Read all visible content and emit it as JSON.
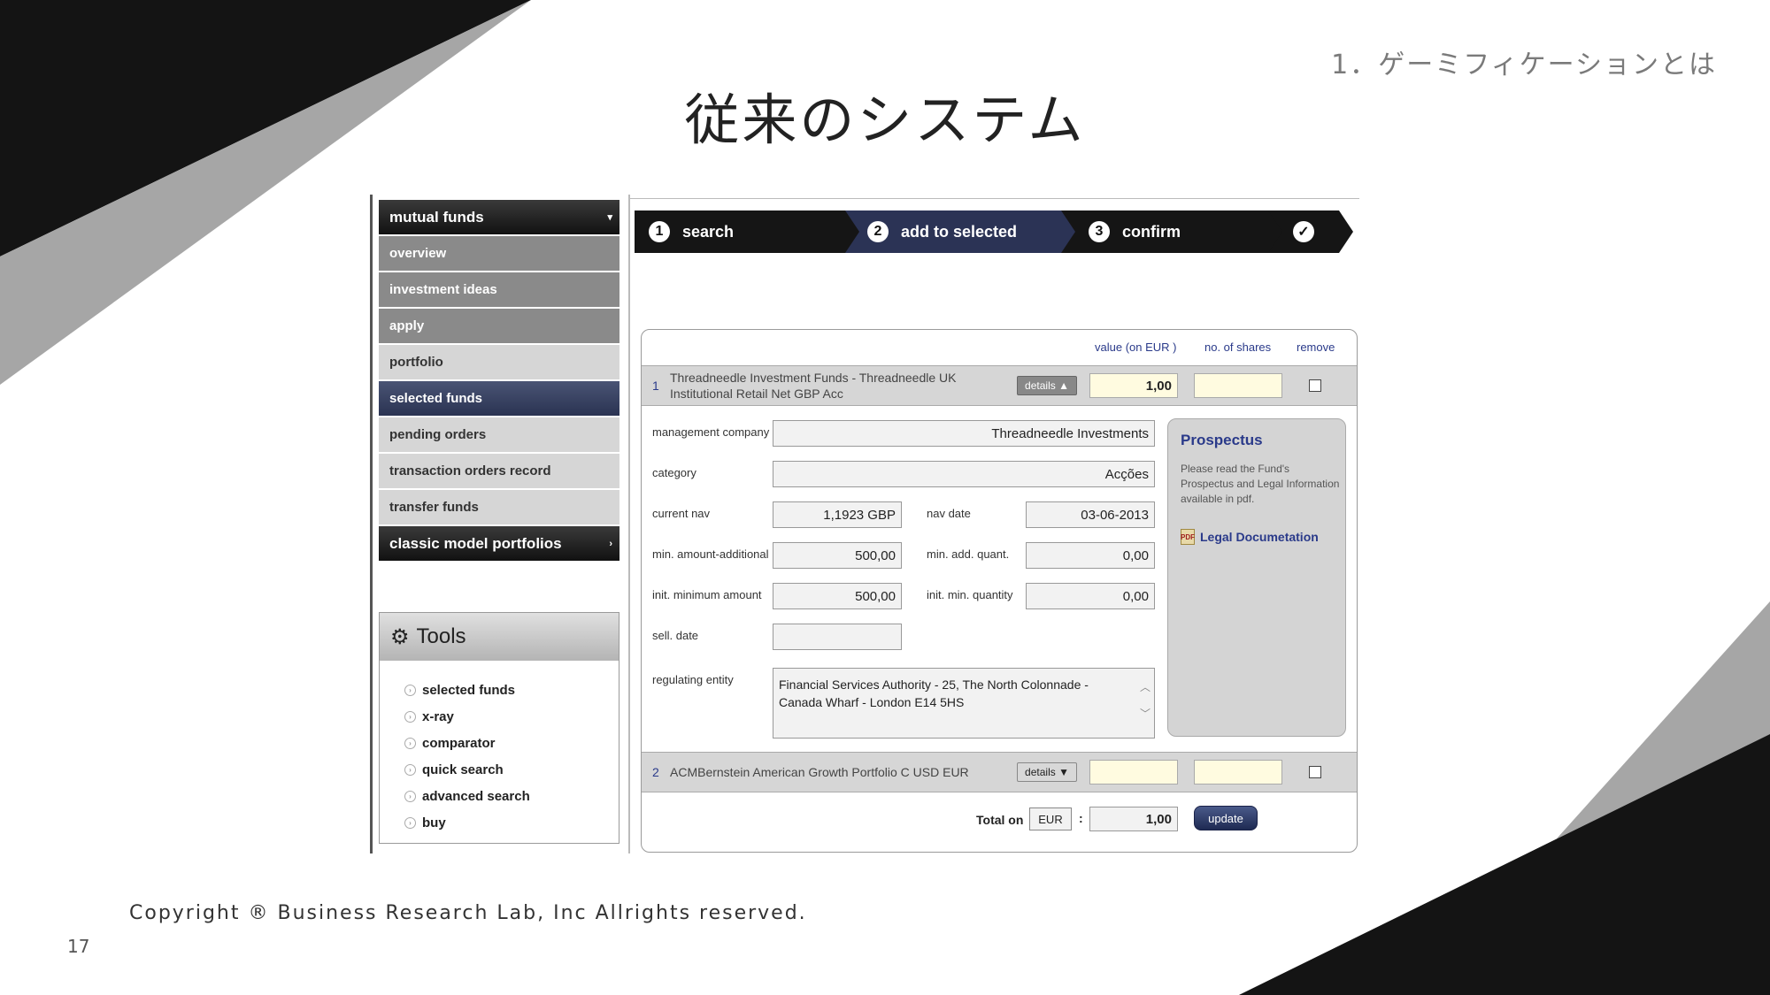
{
  "slide": {
    "section_label": "1．ゲーミフィケーションとは",
    "title": "従来のシステム",
    "copyright": "Copyright ® Business Research Lab, Inc Allrights reserved.",
    "page_number": "17"
  },
  "sidebar": {
    "items": [
      {
        "label": "mutual funds",
        "style": "dark",
        "arrow": "▾"
      },
      {
        "label": "overview",
        "style": "grey"
      },
      {
        "label": "investment ideas",
        "style": "grey"
      },
      {
        "label": "apply",
        "style": "grey"
      },
      {
        "label": "portfolio",
        "style": "light"
      },
      {
        "label": "selected funds",
        "style": "selected"
      },
      {
        "label": "pending orders",
        "style": "light"
      },
      {
        "label": "transaction orders record",
        "style": "light"
      },
      {
        "label": "transfer funds",
        "style": "light"
      },
      {
        "label": "classic model portfolios",
        "style": "dark",
        "arrow": "›"
      }
    ]
  },
  "tools": {
    "title": "Tools",
    "items": [
      "selected funds",
      "x-ray",
      "comparator",
      "quick search",
      "advanced search",
      "buy"
    ]
  },
  "steps": [
    {
      "num": "1",
      "label": "search"
    },
    {
      "num": "2",
      "label": "add to selected"
    },
    {
      "num": "3",
      "label": "confirm"
    },
    {
      "num": "✓",
      "label": ""
    }
  ],
  "table": {
    "col_value": "value (on EUR )",
    "col_shares": "no. of shares",
    "col_remove": "remove",
    "rows": [
      {
        "num": "1",
        "name_line1": "Threadneedle Investment Funds - Threadneedle UK",
        "name_line2": "Institutional Retail Net GBP Acc",
        "details": "details ▲",
        "value": "1,00",
        "shares": ""
      },
      {
        "num": "2",
        "name_line1": "ACMBernstein American Growth Portfolio C USD EUR",
        "details": "details ▼",
        "value": "",
        "shares": ""
      }
    ]
  },
  "detail": {
    "management_company_label": "management company",
    "management_company": "Threadneedle Investments",
    "category_label": "category",
    "category": "Acções",
    "current_nav_label": "current nav",
    "current_nav": "1,1923 GBP",
    "nav_date_label": "nav date",
    "nav_date": "03-06-2013",
    "min_amount_additional_label": "min. amount-additional",
    "min_amount_additional": "500,00",
    "min_add_quant_label": "min. add. quant.",
    "min_add_quant": "0,00",
    "init_minimum_amount_label": "init. minimum amount",
    "init_minimum_amount": "500,00",
    "init_min_quantity_label": "init. min. quantity",
    "init_min_quantity": "0,00",
    "sell_date_label": "sell. date",
    "sell_date": "",
    "regulating_entity_label": "regulating entity",
    "regulating_entity_line1": "Financial Services Authority - 25, The North Colonnade -",
    "regulating_entity_line2": "Canada Wharf - London E14 5HS"
  },
  "prospectus": {
    "title": "Prospectus",
    "text": "Please read the Fund's Prospectus and Legal Information available in pdf.",
    "link": "Legal Documetation"
  },
  "total": {
    "label": "Total on",
    "currency": "EUR",
    "separator": ":",
    "value": "1,00",
    "update": "update"
  },
  "colors": {
    "deco_black": "#141414",
    "deco_grey": "#a6a6a6",
    "nav_selected": "#2f3857",
    "step_active": "#2b3355",
    "link_blue": "#2a3a8a"
  }
}
